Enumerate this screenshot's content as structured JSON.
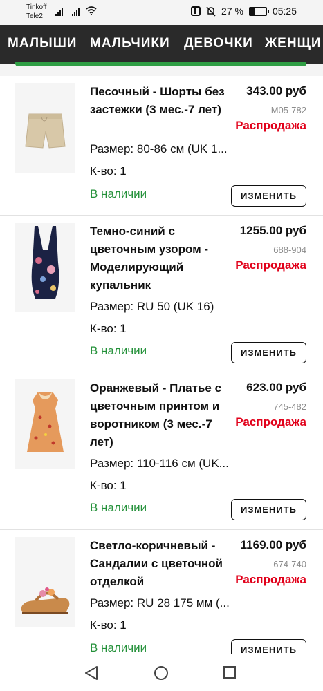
{
  "status_bar": {
    "carrier1": "Tinkoff",
    "carrier2": "Tele2",
    "battery_text": "27 %",
    "battery_level": 0.27,
    "time": "05:25",
    "icons": [
      "signal-icon",
      "wifi-icon",
      "nfc-icon",
      "mute-icon",
      "battery-icon"
    ]
  },
  "categories": [
    "МАЛЫШИ",
    "МАЛЬЧИКИ",
    "ДЕВОЧКИ",
    "ЖЕНЩИ"
  ],
  "colors": {
    "accent_green": "#2f9e44",
    "sale_red": "#e1001a",
    "in_stock_green": "#24913a",
    "nav_bg": "#2a2a2a"
  },
  "items": [
    {
      "title": "Песочный - Шорты без застежки (3 мес.-7 лет)",
      "price": "343.00 руб",
      "code": "M05-782",
      "sale": "Распродажа",
      "size": "Размер: 80-86 см (UK 1...",
      "qty": "К-во: 1",
      "stock": "В наличии",
      "edit_label": "ИЗМЕНИТЬ",
      "image": "shorts-image"
    },
    {
      "title": "Темно-синий с цветочным узором - Моделирующий купальник",
      "price": "1255.00 руб",
      "code": "688-904",
      "sale": "Распродажа",
      "size": "Размер: RU 50 (UK 16)",
      "qty": "К-во: 1",
      "stock": "В наличии",
      "edit_label": "ИЗМЕНИТЬ",
      "image": "swimsuit-image"
    },
    {
      "title": "Оранжевый - Платье с цветочным принтом и воротником (3 мес.-7 лет)",
      "price": "623.00 руб",
      "code": "745-482",
      "sale": "Распродажа",
      "size": "Размер: 110-116 см (UK...",
      "qty": "К-во: 1",
      "stock": "В наличии",
      "edit_label": "ИЗМЕНИТЬ",
      "image": "dress-image"
    },
    {
      "title": "Светло-коричневый - Сандалии с цветочной отделкой",
      "price": "1169.00 руб",
      "code": "674-740",
      "sale": "Распродажа",
      "size": "Размер: RU 28 175 мм (...",
      "qty": "К-во: 1",
      "stock": "В наличии",
      "edit_label": "ИЗМЕНИТЬ",
      "image": "sandals-image"
    }
  ],
  "nav_bar": {
    "icons": [
      "back-icon",
      "home-icon",
      "recents-icon"
    ]
  }
}
